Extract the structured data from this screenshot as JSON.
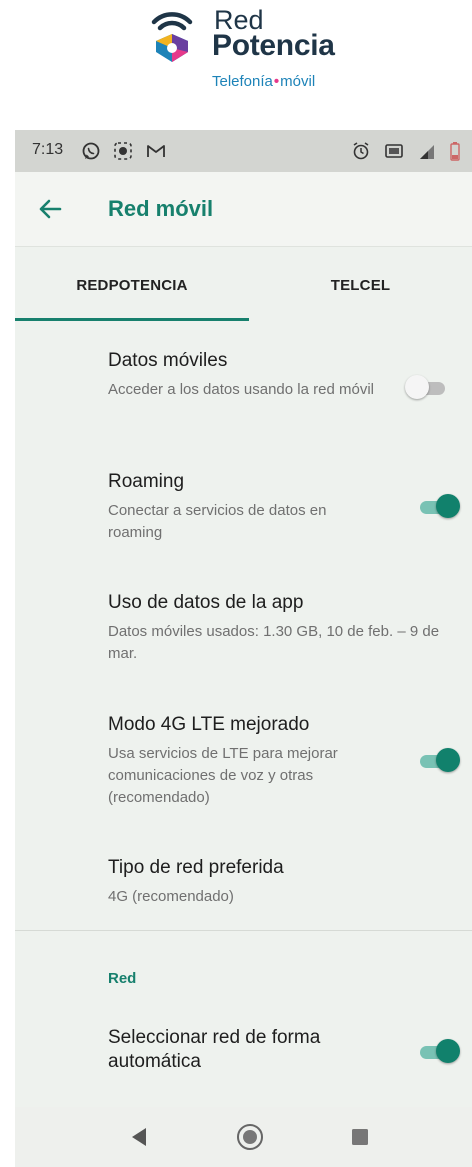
{
  "brand": {
    "name_line1": "Red",
    "name_line2": "Potencia",
    "tagline_part1": "Telefonía",
    "tagline_separator": "•",
    "tagline_part2": "móvil",
    "logo_icon": "wifi-shield-logo-icon",
    "colors": {
      "navy": "#1f3547",
      "blue": "#1d83b8",
      "pink": "#e6398b"
    }
  },
  "status_bar": {
    "time": "7:13",
    "left_icons": [
      "whatsapp-icon",
      "app-notification-icon",
      "gmail-icon"
    ],
    "right_icons": [
      "alarm-icon",
      "cast-icon",
      "signal-icon",
      "battery-icon"
    ]
  },
  "app_bar": {
    "back_icon": "back-arrow-icon",
    "title": "Red móvil"
  },
  "tabs": [
    {
      "label": "REDPOTENCIA",
      "selected": true
    },
    {
      "label": "TELCEL",
      "selected": false
    }
  ],
  "settings": [
    {
      "title": "Datos móviles",
      "subtitle": "Acceder a los datos usando la red móvil",
      "toggle": false
    },
    {
      "title": "Roaming",
      "subtitle": "Conectar a servicios de datos en roaming",
      "toggle": true
    },
    {
      "title": "Uso de datos de la app",
      "subtitle": "Datos móviles usados: 1.30 GB, 10 de feb. – 9 de mar."
    },
    {
      "title": "Modo 4G LTE mejorado",
      "subtitle": "Usa servicios de LTE para mejorar comunicaciones de voz y otras (recomendado)",
      "toggle": true
    },
    {
      "title": "Tipo de red preferida",
      "subtitle": "4G (recomendado)"
    }
  ],
  "section": {
    "label": "Red",
    "items": [
      {
        "title": "Seleccionar red de forma automática",
        "toggle": true
      }
    ]
  },
  "nav_bar": {
    "icons": [
      "back-triangle-icon",
      "home-circle-icon",
      "recents-square-icon"
    ]
  },
  "theme": {
    "accent": "#17806d",
    "toggle_on_thumb": "#11816c",
    "toggle_on_track": "#79c2b4",
    "toggle_off_track": "#bdbdbd",
    "background": "#eef2ee"
  }
}
